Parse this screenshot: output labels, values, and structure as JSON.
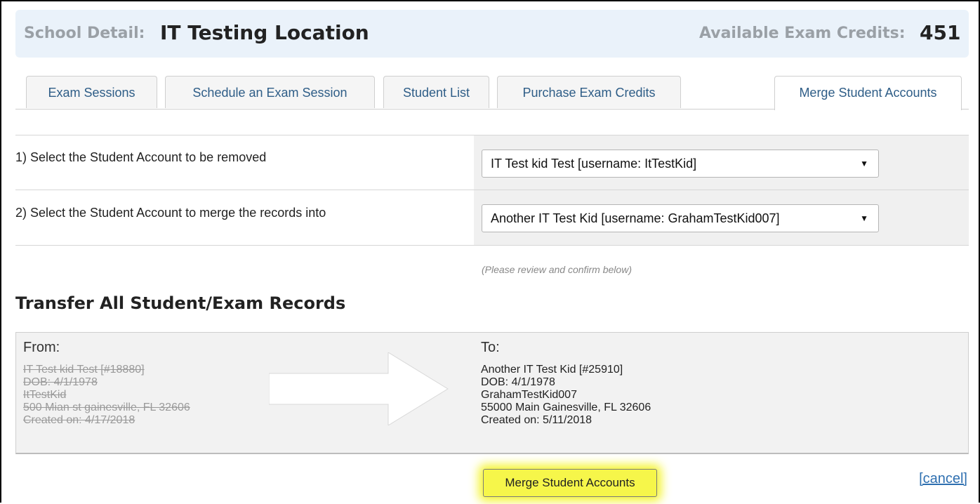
{
  "header": {
    "school_label": "School Detail:",
    "school_name": "IT Testing Location",
    "credits_label": "Available Exam Credits:",
    "credits_value": "451"
  },
  "tabs": [
    {
      "label": "Exam Sessions"
    },
    {
      "label": "Schedule an Exam Session"
    },
    {
      "label": "Student List"
    },
    {
      "label": "Purchase Exam Credits"
    },
    {
      "label": "Merge Student Accounts",
      "active": true
    }
  ],
  "form": {
    "step1_label": "1) Select the Student Account to be removed",
    "step1_value": "IT Test kid Test [username: ItTestKid]",
    "step2_label": "2) Select the Student Account to merge the records into",
    "step2_value": "Another IT Test Kid [username: GrahamTestKid007]",
    "review_note": "(Please review and confirm below)"
  },
  "transfer": {
    "title": "Transfer All Student/Exam Records",
    "from_label": "From:",
    "from_lines": [
      "IT Test kid Test [#18880]",
      "DOB: 4/1/1978",
      "ItTestKid",
      "500 Mian st gainesville, FL 32606",
      "Created on: 4/17/2018"
    ],
    "to_label": "To:",
    "to_lines": [
      "Another IT Test Kid [#25910]",
      "DOB: 4/1/1978",
      "GrahamTestKid007",
      "55000 Main Gainesville, FL 32606",
      "Created on: 5/11/2018"
    ]
  },
  "actions": {
    "merge_label": "Merge Student Accounts",
    "cancel_label": "[cancel]"
  },
  "colors": {
    "header_bg": "#eaf2fa",
    "tab_text": "#2e5d87",
    "highlight": "#f6f64a",
    "link": "#2e6fb0"
  }
}
